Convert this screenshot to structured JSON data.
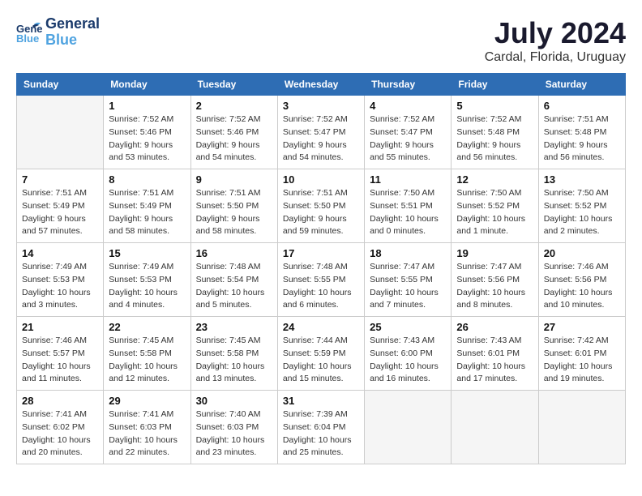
{
  "header": {
    "logo_line1": "General",
    "logo_line2": "Blue",
    "title": "July 2024",
    "subtitle": "Cardal, Florida, Uruguay"
  },
  "days_of_week": [
    "Sunday",
    "Monday",
    "Tuesday",
    "Wednesday",
    "Thursday",
    "Friday",
    "Saturday"
  ],
  "weeks": [
    [
      {
        "day": "",
        "info": ""
      },
      {
        "day": "1",
        "info": "Sunrise: 7:52 AM\nSunset: 5:46 PM\nDaylight: 9 hours\nand 53 minutes."
      },
      {
        "day": "2",
        "info": "Sunrise: 7:52 AM\nSunset: 5:46 PM\nDaylight: 9 hours\nand 54 minutes."
      },
      {
        "day": "3",
        "info": "Sunrise: 7:52 AM\nSunset: 5:47 PM\nDaylight: 9 hours\nand 54 minutes."
      },
      {
        "day": "4",
        "info": "Sunrise: 7:52 AM\nSunset: 5:47 PM\nDaylight: 9 hours\nand 55 minutes."
      },
      {
        "day": "5",
        "info": "Sunrise: 7:52 AM\nSunset: 5:48 PM\nDaylight: 9 hours\nand 56 minutes."
      },
      {
        "day": "6",
        "info": "Sunrise: 7:51 AM\nSunset: 5:48 PM\nDaylight: 9 hours\nand 56 minutes."
      }
    ],
    [
      {
        "day": "7",
        "info": "Sunrise: 7:51 AM\nSunset: 5:49 PM\nDaylight: 9 hours\nand 57 minutes."
      },
      {
        "day": "8",
        "info": "Sunrise: 7:51 AM\nSunset: 5:49 PM\nDaylight: 9 hours\nand 58 minutes."
      },
      {
        "day": "9",
        "info": "Sunrise: 7:51 AM\nSunset: 5:50 PM\nDaylight: 9 hours\nand 58 minutes."
      },
      {
        "day": "10",
        "info": "Sunrise: 7:51 AM\nSunset: 5:50 PM\nDaylight: 9 hours\nand 59 minutes."
      },
      {
        "day": "11",
        "info": "Sunrise: 7:50 AM\nSunset: 5:51 PM\nDaylight: 10 hours\nand 0 minutes."
      },
      {
        "day": "12",
        "info": "Sunrise: 7:50 AM\nSunset: 5:52 PM\nDaylight: 10 hours\nand 1 minute."
      },
      {
        "day": "13",
        "info": "Sunrise: 7:50 AM\nSunset: 5:52 PM\nDaylight: 10 hours\nand 2 minutes."
      }
    ],
    [
      {
        "day": "14",
        "info": "Sunrise: 7:49 AM\nSunset: 5:53 PM\nDaylight: 10 hours\nand 3 minutes."
      },
      {
        "day": "15",
        "info": "Sunrise: 7:49 AM\nSunset: 5:53 PM\nDaylight: 10 hours\nand 4 minutes."
      },
      {
        "day": "16",
        "info": "Sunrise: 7:48 AM\nSunset: 5:54 PM\nDaylight: 10 hours\nand 5 minutes."
      },
      {
        "day": "17",
        "info": "Sunrise: 7:48 AM\nSunset: 5:55 PM\nDaylight: 10 hours\nand 6 minutes."
      },
      {
        "day": "18",
        "info": "Sunrise: 7:47 AM\nSunset: 5:55 PM\nDaylight: 10 hours\nand 7 minutes."
      },
      {
        "day": "19",
        "info": "Sunrise: 7:47 AM\nSunset: 5:56 PM\nDaylight: 10 hours\nand 8 minutes."
      },
      {
        "day": "20",
        "info": "Sunrise: 7:46 AM\nSunset: 5:56 PM\nDaylight: 10 hours\nand 10 minutes."
      }
    ],
    [
      {
        "day": "21",
        "info": "Sunrise: 7:46 AM\nSunset: 5:57 PM\nDaylight: 10 hours\nand 11 minutes."
      },
      {
        "day": "22",
        "info": "Sunrise: 7:45 AM\nSunset: 5:58 PM\nDaylight: 10 hours\nand 12 minutes."
      },
      {
        "day": "23",
        "info": "Sunrise: 7:45 AM\nSunset: 5:58 PM\nDaylight: 10 hours\nand 13 minutes."
      },
      {
        "day": "24",
        "info": "Sunrise: 7:44 AM\nSunset: 5:59 PM\nDaylight: 10 hours\nand 15 minutes."
      },
      {
        "day": "25",
        "info": "Sunrise: 7:43 AM\nSunset: 6:00 PM\nDaylight: 10 hours\nand 16 minutes."
      },
      {
        "day": "26",
        "info": "Sunrise: 7:43 AM\nSunset: 6:01 PM\nDaylight: 10 hours\nand 17 minutes."
      },
      {
        "day": "27",
        "info": "Sunrise: 7:42 AM\nSunset: 6:01 PM\nDaylight: 10 hours\nand 19 minutes."
      }
    ],
    [
      {
        "day": "28",
        "info": "Sunrise: 7:41 AM\nSunset: 6:02 PM\nDaylight: 10 hours\nand 20 minutes."
      },
      {
        "day": "29",
        "info": "Sunrise: 7:41 AM\nSunset: 6:03 PM\nDaylight: 10 hours\nand 22 minutes."
      },
      {
        "day": "30",
        "info": "Sunrise: 7:40 AM\nSunset: 6:03 PM\nDaylight: 10 hours\nand 23 minutes."
      },
      {
        "day": "31",
        "info": "Sunrise: 7:39 AM\nSunset: 6:04 PM\nDaylight: 10 hours\nand 25 minutes."
      },
      {
        "day": "",
        "info": ""
      },
      {
        "day": "",
        "info": ""
      },
      {
        "day": "",
        "info": ""
      }
    ]
  ]
}
